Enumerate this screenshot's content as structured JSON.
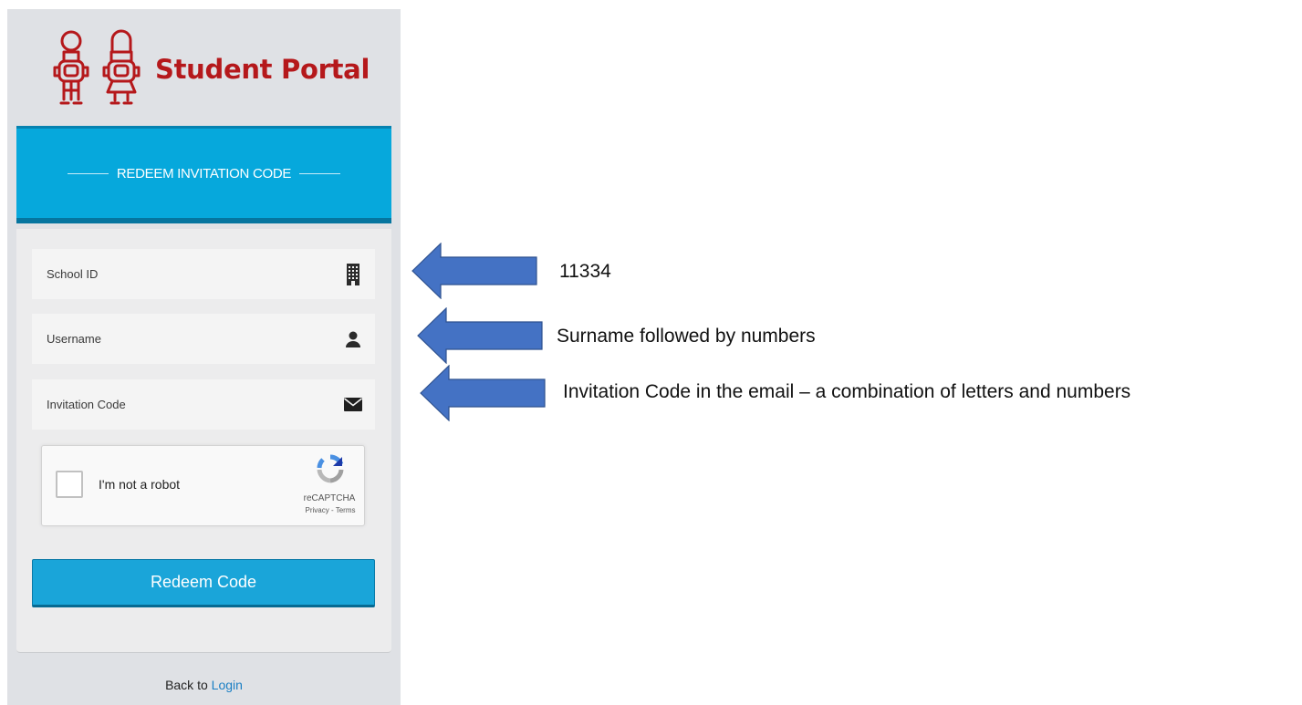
{
  "brand": {
    "title": "Student Portal",
    "logo_icon": "two-students-icon",
    "color": "#b5181b"
  },
  "header": {
    "title": "REDEEM INVITATION CODE",
    "color": "#06a8dc"
  },
  "form": {
    "school_id_placeholder": "School ID",
    "username_placeholder": "Username",
    "invitation_code_placeholder": "Invitation Code",
    "icons": {
      "school_id": "building-icon",
      "username": "user-icon",
      "invitation_code": "envelope-icon"
    }
  },
  "captcha": {
    "label": "I'm not a robot",
    "brand": "reCAPTCHA",
    "links": "Privacy - Terms"
  },
  "submit": {
    "label": "Redeem Code",
    "color": "#1aa5d9"
  },
  "footer": {
    "prefix": "Back to ",
    "link": "Login"
  },
  "annotations": {
    "arrow_color": "#4472c4",
    "school_id_note": "11334",
    "username_note": "Surname followed by numbers",
    "invitation_code_note": "Invitation Code in the email – a combination of letters and numbers"
  }
}
